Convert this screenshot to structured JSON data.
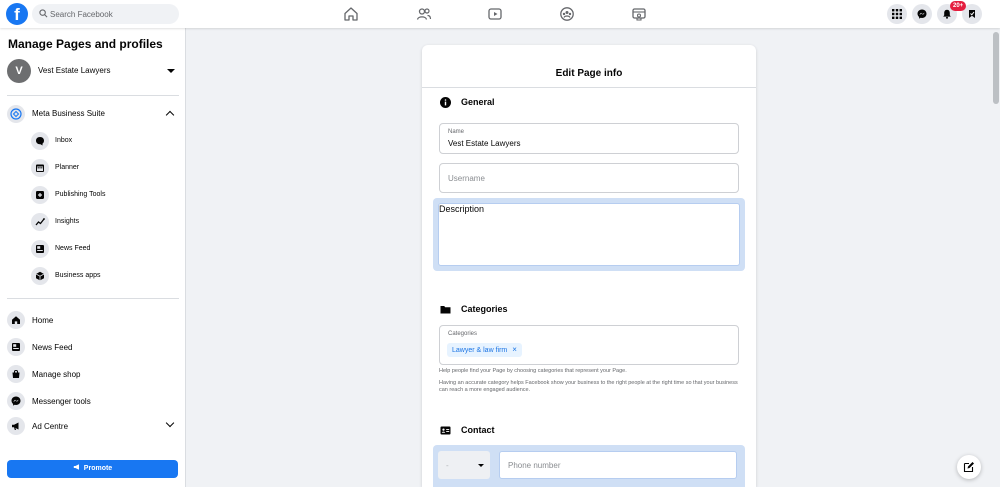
{
  "topbar": {
    "logo": "f",
    "search_placeholder": "Search Facebook",
    "notification_count": "20+",
    "nav_icons": [
      "home-icon",
      "friends-icon",
      "watch-icon",
      "groups-icon",
      "gaming-icon"
    ],
    "right_icons": [
      "menu-grid-icon",
      "messenger-icon",
      "bell-icon",
      "page-avatar-icon"
    ]
  },
  "sidebar": {
    "title": "Manage Pages and profiles",
    "page": {
      "avatar_letter": "V",
      "name": "Vest Estate Lawyers"
    },
    "meta_business_suite": {
      "label": "Meta Business Suite",
      "items": [
        {
          "label": "Inbox",
          "icon": "chat-icon"
        },
        {
          "label": "Planner",
          "icon": "calendar-icon"
        },
        {
          "label": "Publishing Tools",
          "icon": "publishing-icon"
        },
        {
          "label": "Insights",
          "icon": "insights-icon"
        },
        {
          "label": "News Feed",
          "icon": "newsfeed-icon"
        },
        {
          "label": "Business apps",
          "icon": "cube-icon"
        }
      ]
    },
    "items": [
      {
        "label": "Home",
        "icon": "home-icon"
      },
      {
        "label": "News Feed",
        "icon": "newsfeed-icon"
      },
      {
        "label": "Manage shop",
        "icon": "shop-icon"
      },
      {
        "label": "Messenger tools",
        "icon": "messenger-icon"
      },
      {
        "label": "Ad Centre",
        "icon": "megaphone-icon"
      }
    ],
    "promote_label": "Promote"
  },
  "modal": {
    "title": "Edit Page info",
    "general": {
      "heading": "General",
      "name_label": "Name",
      "name_value": "Vest Estate Lawyers",
      "username_placeholder": "Username",
      "description_placeholder": "Description"
    },
    "categories": {
      "heading": "Categories",
      "field_label": "Categories",
      "chip": "Lawyer & law firm",
      "chip_remove": "×",
      "help_1": "Help people find your Page by choosing categories that represent your Page.",
      "help_2": "Having an accurate category helps Facebook show your business to the right people at the right time so that your business can reach a more engaged audience."
    },
    "contact": {
      "heading": "Contact",
      "country_value": "-",
      "phone_placeholder": "Phone number"
    }
  },
  "colors": {
    "brand": "#1877f2",
    "focus": "#cfdff5",
    "badge": "#e41e3f",
    "chip_bg": "#e7f3ff"
  }
}
